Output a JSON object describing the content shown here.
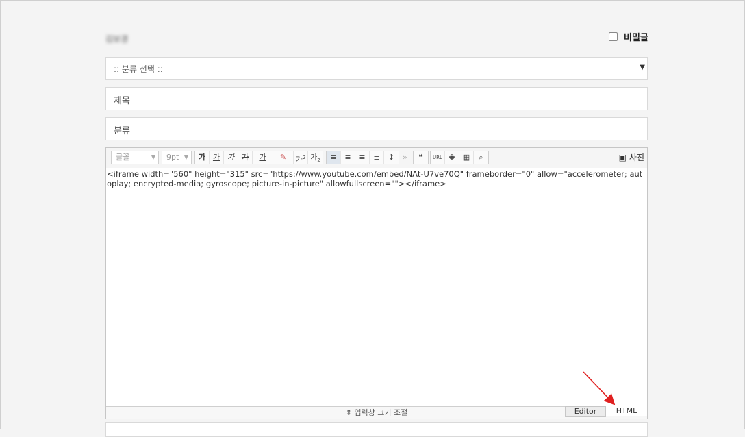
{
  "header": {
    "author": "김보경",
    "secret_label": "비밀글"
  },
  "category_select": {
    "value": ":: 분류 선택 ::"
  },
  "title_field": {
    "placeholder": "제목"
  },
  "tag_field": {
    "placeholder": "분류"
  },
  "toolbar": {
    "font": "글꼴",
    "size": "9pt",
    "bold": "가",
    "underline": "가",
    "italic": "가",
    "strike": "가",
    "color": "가",
    "sup": "가",
    "sub": "가",
    "quote": "❝",
    "url": "URL",
    "photo": "사진"
  },
  "content": {
    "html": "<iframe width=\"560\" height=\"315\" src=\"https://www.youtube.com/embed/NAt-U7ve70Q\" frameborder=\"0\" allow=\"accelerometer; autoplay; encrypted-media; gyroscope; picture-in-picture\" allowfullscreen=\"\"></iframe>"
  },
  "footer": {
    "resize_label": "입력창 크기 조절",
    "tab_editor": "Editor",
    "tab_html": "HTML"
  },
  "colors": {
    "annotation_arrow": "#e02020"
  }
}
